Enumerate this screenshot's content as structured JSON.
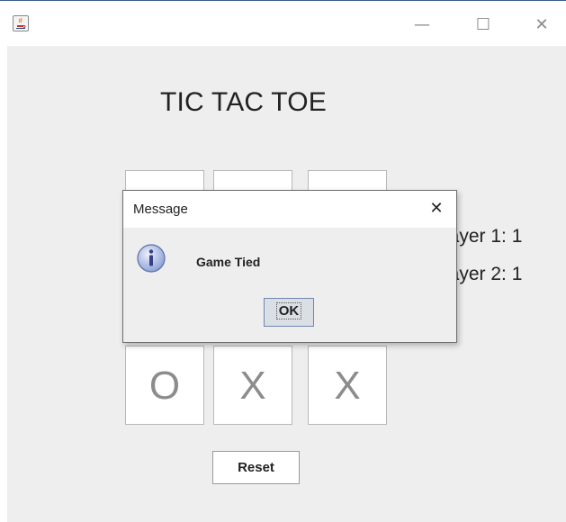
{
  "window": {
    "controls": {
      "minimize": "—",
      "maximize": "☐",
      "close": "✕"
    }
  },
  "game": {
    "title": "TIC TAC TOE",
    "board_visible_row": [
      "O",
      "X",
      "X"
    ],
    "scores": {
      "player1": "Player 1: 1",
      "player2": "Player 2: 1"
    },
    "reset_label": "Reset"
  },
  "dialog": {
    "title": "Message",
    "close": "✕",
    "icon": "info-icon",
    "message": "Game Tied",
    "ok_label": "OK"
  },
  "colors": {
    "content_bg": "#eeeeee",
    "cell_bg": "#ffffff",
    "mark_color": "#8c8c8c",
    "ok_button_bg": "#dadfe6",
    "info_icon": "#8fa3d8"
  }
}
